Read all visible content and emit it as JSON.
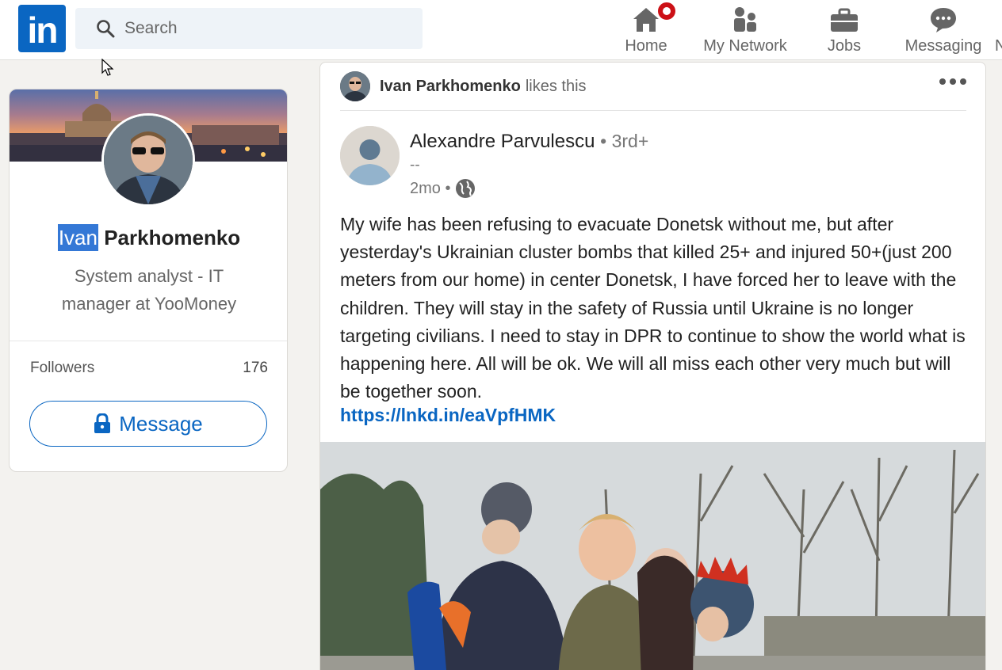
{
  "nav": {
    "logo_text": "in",
    "search_placeholder": "Search",
    "items": [
      {
        "label": "Home",
        "icon": "home-icon"
      },
      {
        "label": "My Network",
        "icon": "people-icon"
      },
      {
        "label": "Jobs",
        "icon": "briefcase-icon"
      },
      {
        "label": "Messaging",
        "icon": "chat-icon"
      }
    ],
    "overflow_label": "N"
  },
  "profile": {
    "first_name": "Ivan",
    "last_name": "Parkhomenko",
    "title": "System analyst - IT manager at YooMoney",
    "followers_label": "Followers",
    "followers_count": "176",
    "message_button": "Message"
  },
  "post": {
    "liker_name": "Ivan Parkhomenko",
    "liker_action": "likes this",
    "author_name": "Alexandre Parvulescu",
    "author_degree": "• 3rd+",
    "author_headline": "--",
    "age": "2mo •",
    "body": "My wife has been refusing to evacuate Donetsk without me, but after yesterday's Ukrainian cluster bombs that killed 25+ and injured 50+(just 200 meters from our home) in center Donetsk, I have forced her to leave with the children. They will stay in the safety of Russia until Ukraine is no longer targeting civilians. I need to stay in DPR to continue to show the world what is happening here. All will be ok. We will all miss each other very much but will be together soon.",
    "link": "https://lnkd.in/eaVpfHMK"
  },
  "colors": {
    "brand": "#0a66c2",
    "badge": "#cc1016",
    "background": "#f3f2ef"
  }
}
